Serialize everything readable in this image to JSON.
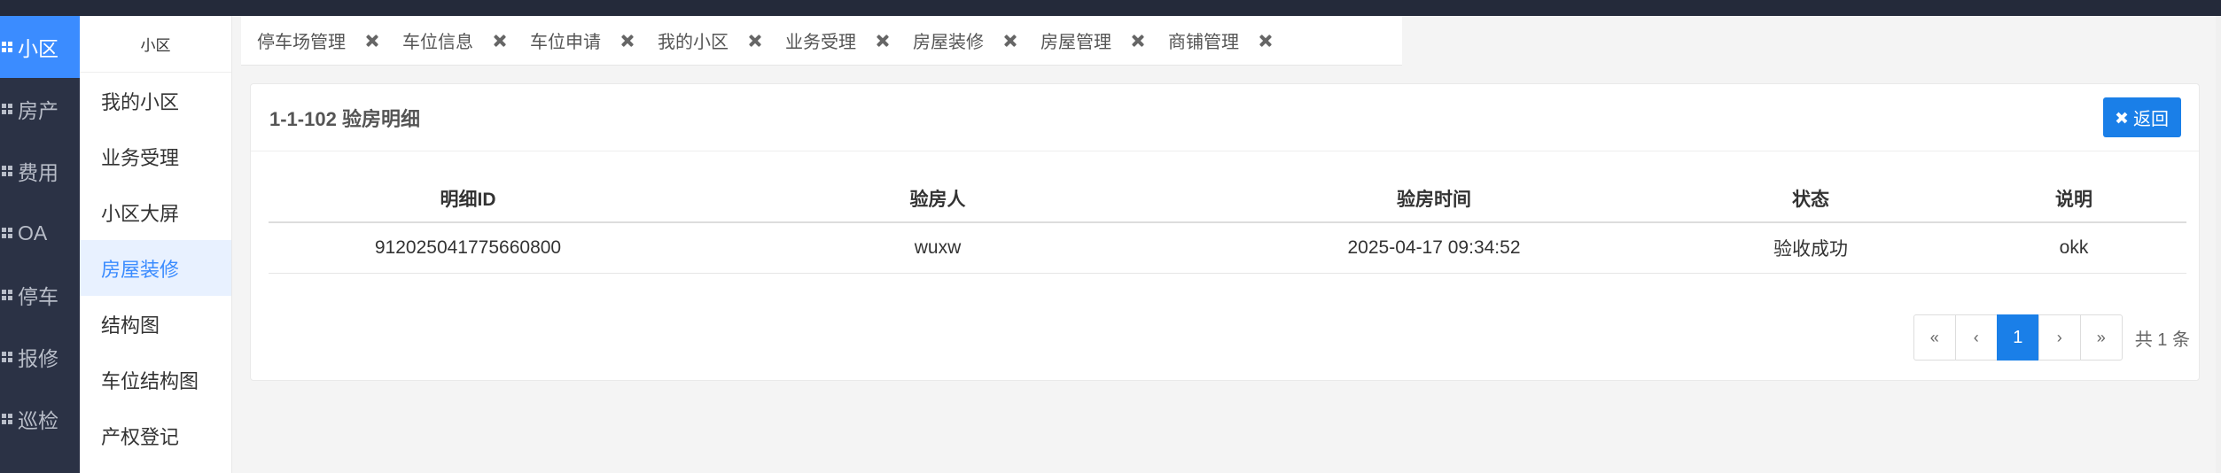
{
  "rail": [
    {
      "label": "小区",
      "icon": "grid-icon",
      "active": true
    },
    {
      "label": "房产",
      "icon": "grid-icon"
    },
    {
      "label": "费用",
      "icon": "grid-icon"
    },
    {
      "label": "OA",
      "icon": "grid-icon"
    },
    {
      "label": "停车",
      "icon": "grid-icon"
    },
    {
      "label": "报修",
      "icon": "grid-icon"
    },
    {
      "label": "巡检",
      "icon": "grid-icon"
    }
  ],
  "submenu": {
    "title": "小区",
    "items": [
      "我的小区",
      "业务受理",
      "小区大屏",
      "房屋装修",
      "结构图",
      "车位结构图",
      "产权登记"
    ],
    "active_index": 3
  },
  "tabs": [
    "停车场管理",
    "车位信息",
    "车位申请",
    "我的小区",
    "业务受理",
    "房屋装修",
    "房屋管理",
    "商铺管理"
  ],
  "card": {
    "title": "1-1-102 验房明细",
    "back_label": "返回"
  },
  "table": {
    "headers": [
      "明细ID",
      "验房人",
      "验房时间",
      "状态",
      "说明"
    ],
    "rows": [
      [
        "912025041775660800",
        "wuxw",
        "2025-04-17 09:34:52",
        "验收成功",
        "okk"
      ]
    ]
  },
  "pager": {
    "first": "«",
    "prev": "‹",
    "current": "1",
    "next": "›",
    "last": "»",
    "total": "共 1 条"
  },
  "colors": {
    "accent": "#1a7fe8",
    "rail_bg": "#2b3245",
    "rail_active": "#3b8cff"
  }
}
